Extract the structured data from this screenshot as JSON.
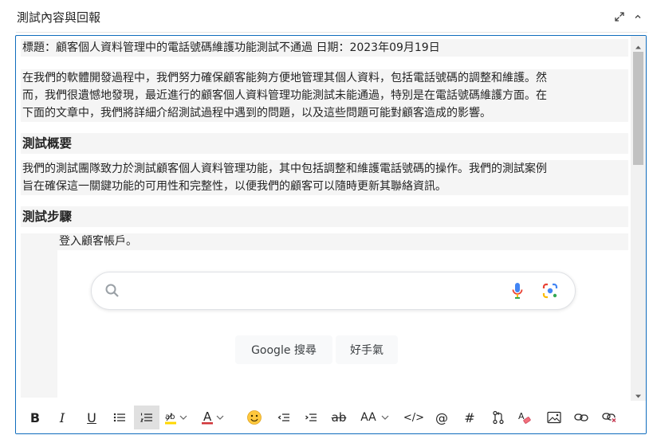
{
  "panel": {
    "title": "測試內容與回報",
    "expand_icon": "expand-diagonal-icon",
    "collapse_icon": "chevron-up-icon"
  },
  "document": {
    "title_line": "標題：顧客個人資料管理中的電話號碼維護功能測試不通過 日期：2023年09月19日",
    "intro_lines": [
      "在我們的軟體開發過程中，我們努力確保顧客能夠方便地管理其個人資料，包括電話號碼的調整和維護。然",
      "而，我們很遺憾地發現，最近進行的顧客個人資料管理功能測試未能通過，特別是在電話號碼維護方面。在",
      "下面的文章中，我們將詳細介紹測試過程中遇到的問題，以及這些問題可能對顧客造成的影響。"
    ],
    "overview_heading": "測試概要",
    "overview_lines": [
      "我們的測試團隊致力於測試顧客個人資料管理功能，其中包括調整和維護電話號碼的操作。我們的測試案例",
      "旨在確保這一關鍵功能的可用性和完整性，以便我們的顧客可以隨時更新其聯絡資訊。"
    ],
    "steps_heading": "測試步驟",
    "step_1": "登入顧客帳戶。",
    "embedded_screenshot": {
      "search_button": "Google 搜尋",
      "lucky_button": "好手氣"
    }
  },
  "toolbar": {
    "bold": "B",
    "italic": "I",
    "underline": "U",
    "strike": "ab",
    "font_size": "AA",
    "code": "</>",
    "mention": "@",
    "hashtag": "#",
    "font_color_letter": "A",
    "highlight_letters": "ab"
  },
  "colors": {
    "accent_border": "#0f6cbd",
    "highlight_yellow": "#ffd700",
    "font_color_red": "#d13438",
    "emoji_yellow": "#ffc83d"
  }
}
